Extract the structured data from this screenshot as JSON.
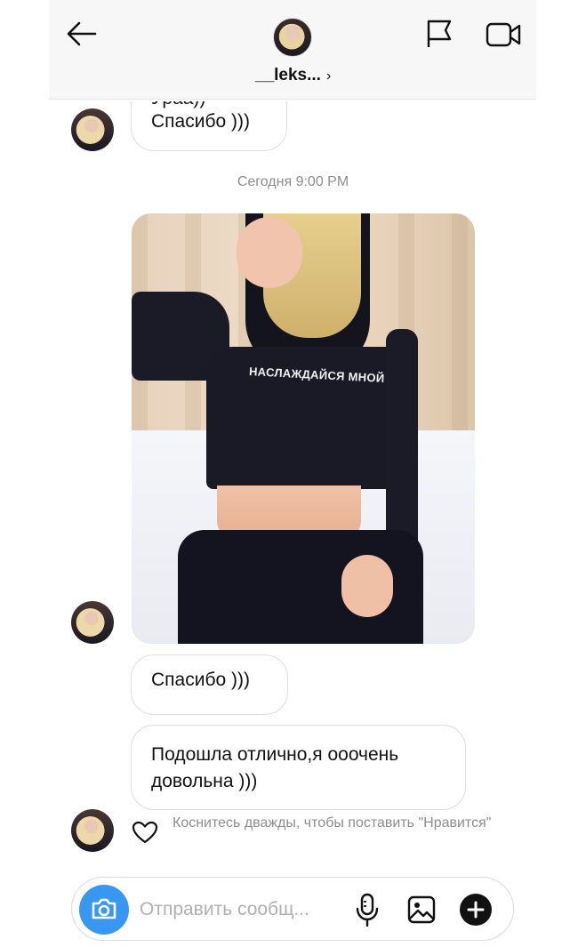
{
  "header": {
    "username": "__leks...",
    "chevron": "›",
    "icons": {
      "back": "arrow-left-icon",
      "flag": "flag-icon",
      "video": "video-camera-icon"
    }
  },
  "messages": {
    "top_cut_text": "Ураа))",
    "top_text": "Спасибо )))",
    "timestamp": "Сегодня 9:00 PM",
    "photo_print": "НАСЛАЖДАЙСЯ МНОЙ",
    "reply1": "Спасибо )))",
    "reply2_line1": "Подошла отлично,я ооочень",
    "reply2_line2": "довольна )))",
    "like_hint": "Коснитесь дважды, чтобы поставить \"Нравится\""
  },
  "composer": {
    "placeholder": "Отправить сообщ...",
    "value": "",
    "icons": {
      "camera": "camera-icon",
      "mic": "microphone-icon",
      "gallery": "image-icon",
      "add": "plus-icon"
    }
  },
  "colors": {
    "accent": "#3897f0",
    "hint": "#8e8e8e",
    "border": "#dedede"
  }
}
